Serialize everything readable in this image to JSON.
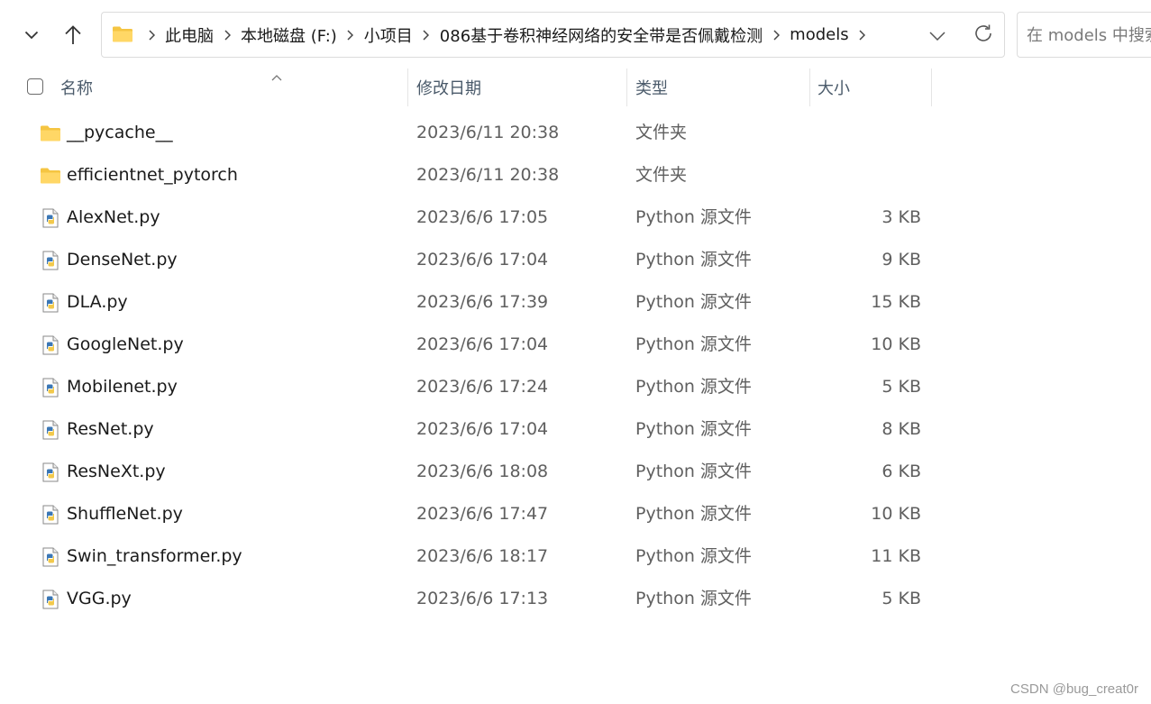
{
  "address": {
    "crumbs": [
      "此电脑",
      "本地磁盘 (F:)",
      "小项目",
      "086基于卷积神经网络的安全带是否佩戴检测",
      "models"
    ]
  },
  "search": {
    "placeholder": "在 models 中搜索"
  },
  "columns": {
    "name": "名称",
    "date": "修改日期",
    "type": "类型",
    "size": "大小"
  },
  "files": [
    {
      "name": "__pycache__",
      "date": "2023/6/11 20:38",
      "type": "文件夹",
      "size": "",
      "kind": "folder"
    },
    {
      "name": "efficientnet_pytorch",
      "date": "2023/6/11 20:38",
      "type": "文件夹",
      "size": "",
      "kind": "folder"
    },
    {
      "name": "AlexNet.py",
      "date": "2023/6/6 17:05",
      "type": "Python 源文件",
      "size": "3 KB",
      "kind": "python"
    },
    {
      "name": "DenseNet.py",
      "date": "2023/6/6 17:04",
      "type": "Python 源文件",
      "size": "9 KB",
      "kind": "python"
    },
    {
      "name": "DLA.py",
      "date": "2023/6/6 17:39",
      "type": "Python 源文件",
      "size": "15 KB",
      "kind": "python"
    },
    {
      "name": "GoogleNet.py",
      "date": "2023/6/6 17:04",
      "type": "Python 源文件",
      "size": "10 KB",
      "kind": "python"
    },
    {
      "name": "Mobilenet.py",
      "date": "2023/6/6 17:24",
      "type": "Python 源文件",
      "size": "5 KB",
      "kind": "python"
    },
    {
      "name": "ResNet.py",
      "date": "2023/6/6 17:04",
      "type": "Python 源文件",
      "size": "8 KB",
      "kind": "python"
    },
    {
      "name": "ResNeXt.py",
      "date": "2023/6/6 18:08",
      "type": "Python 源文件",
      "size": "6 KB",
      "kind": "python"
    },
    {
      "name": "ShuffleNet.py",
      "date": "2023/6/6 17:47",
      "type": "Python 源文件",
      "size": "10 KB",
      "kind": "python"
    },
    {
      "name": "Swin_transformer.py",
      "date": "2023/6/6 18:17",
      "type": "Python 源文件",
      "size": "11 KB",
      "kind": "python"
    },
    {
      "name": "VGG.py",
      "date": "2023/6/6 17:13",
      "type": "Python 源文件",
      "size": "5 KB",
      "kind": "python"
    }
  ],
  "watermark": "CSDN @bug_creat0r",
  "colors": {
    "folder": "#f5c542",
    "python_blue": "#3b77b5",
    "python_yellow": "#f2c94c",
    "header_text": "#4a5a6a"
  }
}
